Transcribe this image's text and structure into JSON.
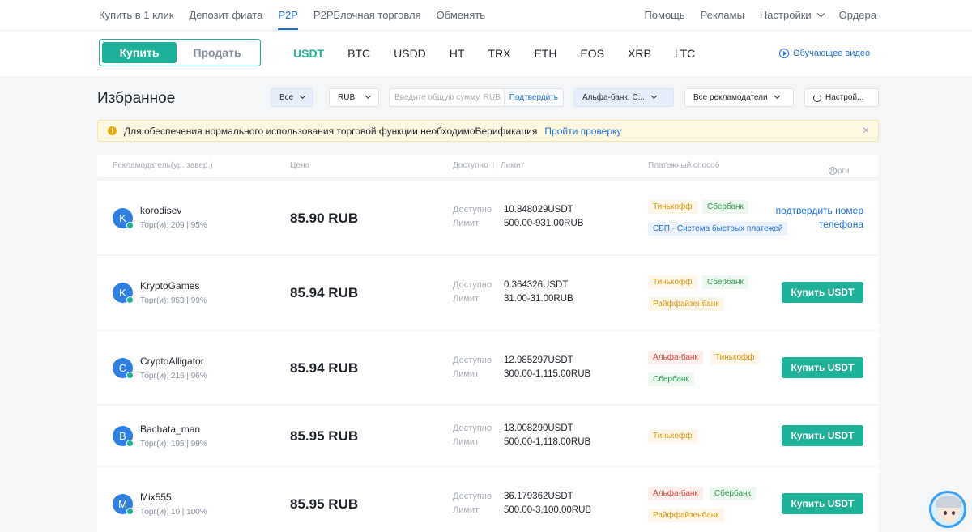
{
  "topnav": {
    "left": [
      "Купить в 1 клик",
      "Депозит фиата",
      "P2P",
      "P2PБлочная торговля",
      "Обменять"
    ],
    "right": [
      "Помощь",
      "Рекламы",
      "Настройки",
      "Ордера"
    ]
  },
  "trade": {
    "buy": "Купить",
    "sell": "Продать",
    "coins": [
      "USDT",
      "BTC",
      "USDD",
      "HT",
      "TRX",
      "ETH",
      "EOS",
      "XRP",
      "LTC"
    ],
    "video": "Обучающее видео"
  },
  "favorites_title": "Избранное",
  "filters": {
    "all": "Все",
    "currency": "RUB",
    "amount_placeholder": "Введите общую сумму",
    "amount_currency": "RUB",
    "confirm": "Подтвердить",
    "payment": "Альфа-банк, С...",
    "advertisers": "Все рекламодатели",
    "settings": "Настрой..."
  },
  "notice": {
    "text": "Для обеспечения нормального использования торговой функции необходимоВерификация",
    "link": "Пройти проверку"
  },
  "columns": {
    "advertiser": "Рекламодатель(ур. завер.)",
    "price": "Цена",
    "available": "Доступно",
    "limit": "Лимит",
    "payment": "Платежный способ",
    "trade": "Торги"
  },
  "labels": {
    "available": "Доступно",
    "limit": "Лимит"
  },
  "rows": [
    {
      "initial": "K",
      "name": "korodisev",
      "stats": "Торг(и): 209 | 95%",
      "price": "85.90 RUB",
      "available": "10.848029USDT",
      "limit": "500.00-931.00RUB",
      "tags": [
        {
          "text": "Тинькофф",
          "color": "orange"
        },
        {
          "text": "Сбербанк",
          "color": "green"
        },
        {
          "text": "СБП - Система быстрых платежей",
          "color": "blue"
        }
      ],
      "action": "подтвердить номер телефона"
    },
    {
      "initial": "K",
      "name": "KryptoGames",
      "stats": "Торг(и): 953 | 99%",
      "price": "85.94 RUB",
      "available": "0.364326USDT",
      "limit": "31.00-31.00RUB",
      "tags": [
        {
          "text": "Тинькофф",
          "color": "orange"
        },
        {
          "text": "Сбербанк",
          "color": "green"
        },
        {
          "text": "Райффайзенбанк",
          "color": "orange"
        }
      ],
      "action": "Купить USDT"
    },
    {
      "initial": "C",
      "name": "CryptoAlligator",
      "stats": "Торг(и): 216 | 96%",
      "price": "85.94 RUB",
      "available": "12.985297USDT",
      "limit": "300.00-1,115.00RUB",
      "tags": [
        {
          "text": "Альфа-банк",
          "color": "red"
        },
        {
          "text": "Тинькофф",
          "color": "orange"
        },
        {
          "text": "Сбербанк",
          "color": "green"
        }
      ],
      "action": "Купить USDT"
    },
    {
      "initial": "B",
      "name": "Bachata_man",
      "stats": "Торг(и): 195 | 99%",
      "price": "85.95 RUB",
      "available": "13.008290USDT",
      "limit": "500.00-1,118.00RUB",
      "tags": [
        {
          "text": "Тинькофф",
          "color": "orange"
        }
      ],
      "action": "Купить USDT"
    },
    {
      "initial": "M",
      "name": "Mix555",
      "stats": "Торг(и): 10 | 100%",
      "price": "85.95 RUB",
      "available": "36.179362USDT",
      "limit": "500.00-3,100.00RUB",
      "tags": [
        {
          "text": "Альфа-банк",
          "color": "red"
        },
        {
          "text": "Сбербанк",
          "color": "green"
        },
        {
          "text": "Райффайзенбанк",
          "color": "orange"
        }
      ],
      "action": "Купить USDT"
    }
  ]
}
